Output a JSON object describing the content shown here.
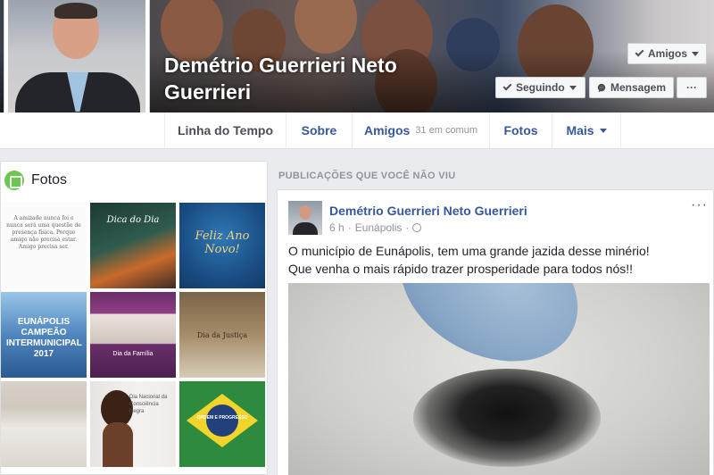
{
  "profile": {
    "name": "Demétrio Guerrieri Neto Guerrieri",
    "buttons": {
      "friends": "Amigos",
      "following": "Seguindo",
      "message": "Mensagem",
      "more": "···"
    }
  },
  "nav": {
    "timeline": "Linha do Tempo",
    "about": "Sobre",
    "friends": "Amigos",
    "friends_mutual": "31 em comum",
    "photos": "Fotos",
    "more": "Mais"
  },
  "photos": {
    "title": "Fotos",
    "tiles": [
      {
        "caption": "A amizade nunca foi e nunca será uma questão de presença física. Porque amigo não precisa estar. Amigo precisa ser."
      },
      {
        "caption": "Dica do Dia"
      },
      {
        "caption": "Feliz Ano Novo!"
      },
      {
        "caption": "EUNÁPOLIS CAMPEÃO INTERMUNICIPAL 2017"
      },
      {
        "caption": "Dia da Família"
      },
      {
        "caption": "Dia da Justiça"
      },
      {
        "caption": ""
      },
      {
        "caption": "Dia Nacional da Consciência Negra"
      },
      {
        "caption": "ORDEM E PROGRESSO"
      }
    ]
  },
  "feed": {
    "label": "PUBLICAÇÕES QUE VOCÊ NÃO VIU"
  },
  "post": {
    "author": "Demétrio Guerrieri Neto Guerrieri",
    "time": "6 h",
    "separator": "·",
    "location": "Eunápolis",
    "more": "···",
    "line1": "O município de Eunápolis, tem uma grande jazida desse minério!",
    "line2": "Que venha o mais rápido trazer prosperidade para todos nós!!"
  }
}
